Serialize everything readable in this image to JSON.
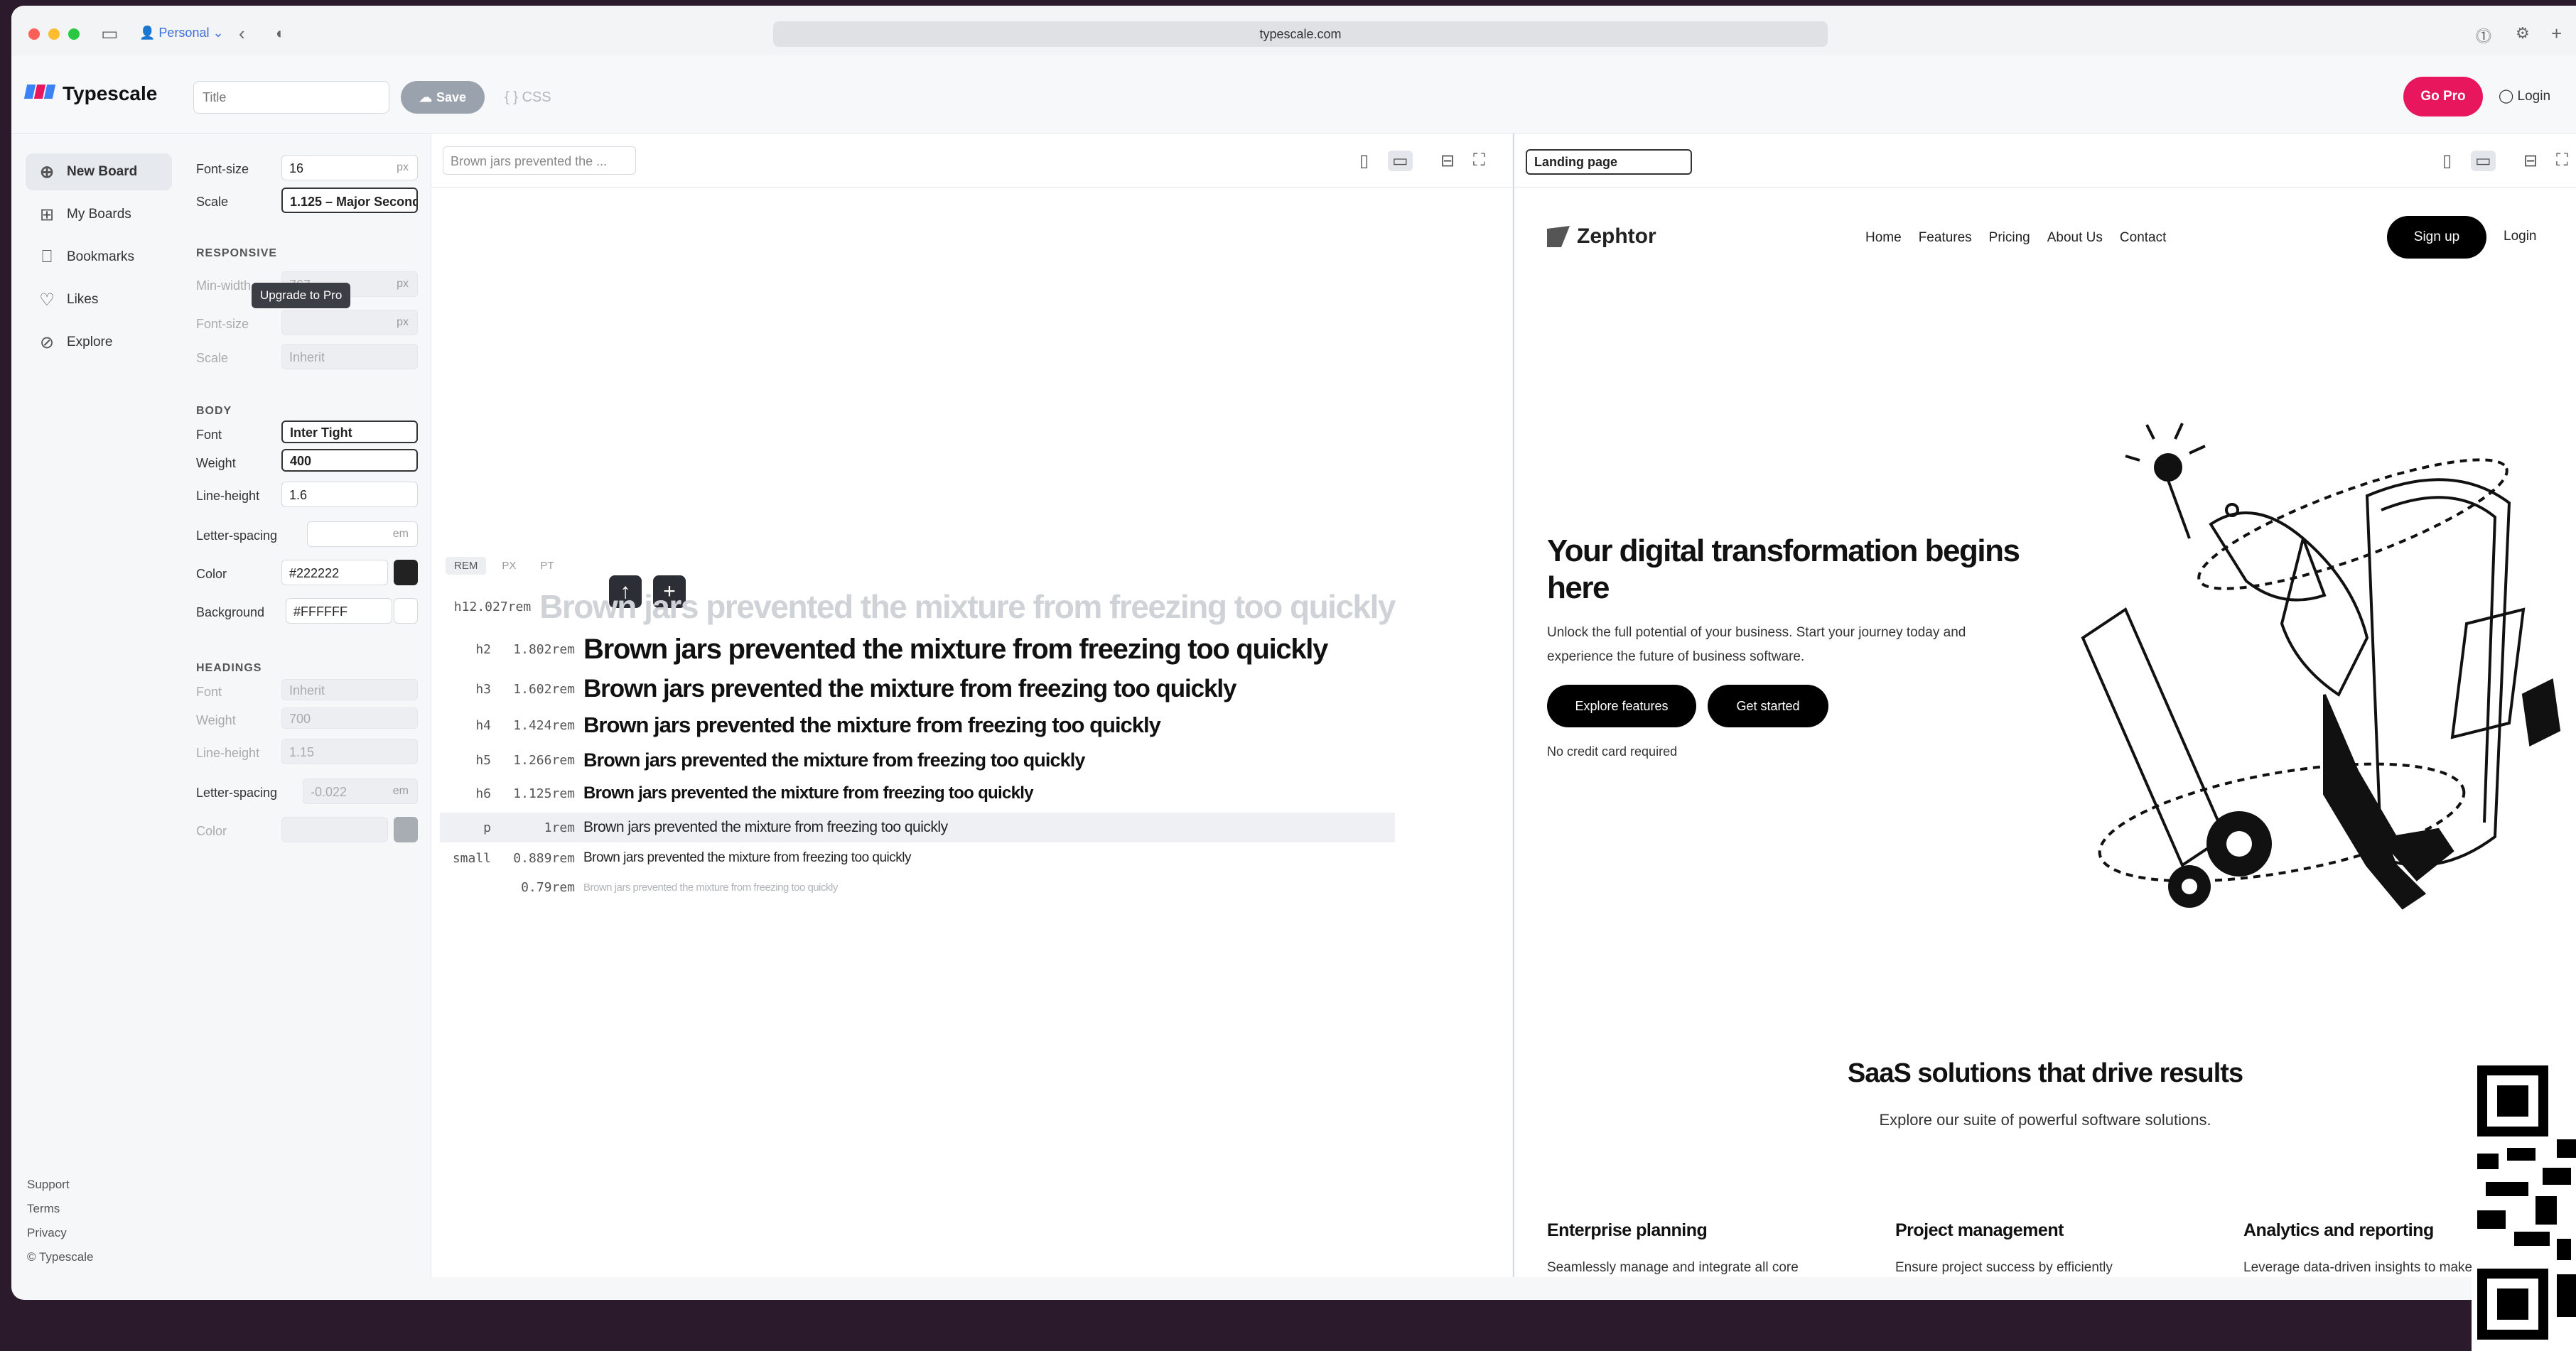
{
  "browser": {
    "profile": "Personal",
    "url": "typescale.com"
  },
  "app": {
    "brand": "Typescale",
    "title_placeholder": "Title",
    "save_label": "Save",
    "css_label": "{ } CSS",
    "go_pro_label": "Go Pro",
    "login_label": "Login"
  },
  "nav": {
    "items": [
      {
        "label": "New Board",
        "icon": "plus-circle-icon"
      },
      {
        "label": "My Boards",
        "icon": "grid-icon"
      },
      {
        "label": "Bookmarks",
        "icon": "bookmark-icon"
      },
      {
        "label": "Likes",
        "icon": "heart-icon"
      },
      {
        "label": "Explore",
        "icon": "compass-icon"
      }
    ],
    "footer": [
      "Support",
      "Terms",
      "Privacy",
      "© Typescale"
    ]
  },
  "settings": {
    "font_size_label": "Font-size",
    "font_size_value": "16",
    "font_size_unit": "px",
    "scale_label": "Scale",
    "scale_value": "1.125 – Major Second",
    "responsive_heading": "RESPONSIVE",
    "min_width_label": "Min-width",
    "min_width_value": "767",
    "min_width_unit": "px",
    "upgrade_tooltip": "Upgrade to Pro",
    "resp_font_size_label": "Font-size",
    "resp_font_size_unit": "px",
    "resp_scale_label": "Scale",
    "resp_scale_value": "Inherit",
    "body_heading": "BODY",
    "font_label": "Font",
    "font_value": "Inter Tight",
    "weight_label": "Weight",
    "weight_value": "400",
    "line_height_label": "Line-height",
    "line_height_value": "1.6",
    "letter_spacing_label": "Letter-spacing",
    "letter_spacing_unit": "em",
    "color_label": "Color",
    "color_value": "#222222",
    "background_label": "Background",
    "background_value": "#FFFFFF",
    "headings_heading": "HEADINGS",
    "h_font_label": "Font",
    "h_font_value": "Inherit",
    "h_weight_label": "Weight",
    "h_weight_value": "700",
    "h_line_height_label": "Line-height",
    "h_line_height_value": "1.15",
    "h_letter_spacing_label": "Letter-spacing",
    "h_letter_spacing_value": "-0.022",
    "h_letter_spacing_unit": "em",
    "h_color_label": "Color"
  },
  "preview": {
    "title_value": "Brown jars prevented the ...",
    "unit_tabs": [
      "REM",
      "PX",
      "PT"
    ],
    "rows": [
      {
        "tag": "h1",
        "rem": "2.027rem",
        "text": "Brown jars prevented the mixture from freezing too quickly"
      },
      {
        "tag": "h2",
        "rem": "1.802rem",
        "text": "Brown jars prevented the mixture from freezing too quickly"
      },
      {
        "tag": "h3",
        "rem": "1.602rem",
        "text": "Brown jars prevented the mixture from freezing too quickly"
      },
      {
        "tag": "h4",
        "rem": "1.424rem",
        "text": "Brown jars prevented the mixture from freezing too quickly"
      },
      {
        "tag": "h5",
        "rem": "1.266rem",
        "text": "Brown jars prevented the mixture from freezing too quickly"
      },
      {
        "tag": "h6",
        "rem": "1.125rem",
        "text": "Brown jars prevented the mixture from freezing too quickly"
      },
      {
        "tag": "p",
        "rem": "1rem",
        "text": "Brown jars prevented the mixture from freezing too quickly"
      },
      {
        "tag": "small",
        "rem": "0.889rem",
        "text": "Brown jars prevented the mixture from freezing too quickly"
      },
      {
        "tag": "",
        "rem": "0.79rem",
        "text": "Brown jars prevented the mixture from freezing too quickly"
      }
    ]
  },
  "site": {
    "template": "Landing page",
    "logo": "Zephtor",
    "nav": [
      "Home",
      "Features",
      "Pricing",
      "About Us",
      "Contact"
    ],
    "signup": "Sign up",
    "login": "Login",
    "hero_title": "Your digital transformation begins here",
    "hero_text": "Unlock the full potential of your business. Start your journey today and experience the future of business software.",
    "btn_explore": "Explore features",
    "btn_start": "Get started",
    "no_cc": "No credit card required",
    "saas_title": "SaaS solutions that drive results",
    "saas_sub": "Explore our suite of powerful software solutions.",
    "features": [
      {
        "title": "Enterprise planning",
        "text": "Seamlessly manage and integrate all core"
      },
      {
        "title": "Project management",
        "text": "Ensure project success by efficiently"
      },
      {
        "title": "Analytics and reporting",
        "text": "Leverage data-driven insights to make"
      }
    ]
  },
  "colors": {
    "accent": "#e8175d",
    "body_text": "#222222",
    "dark": "#000000"
  }
}
